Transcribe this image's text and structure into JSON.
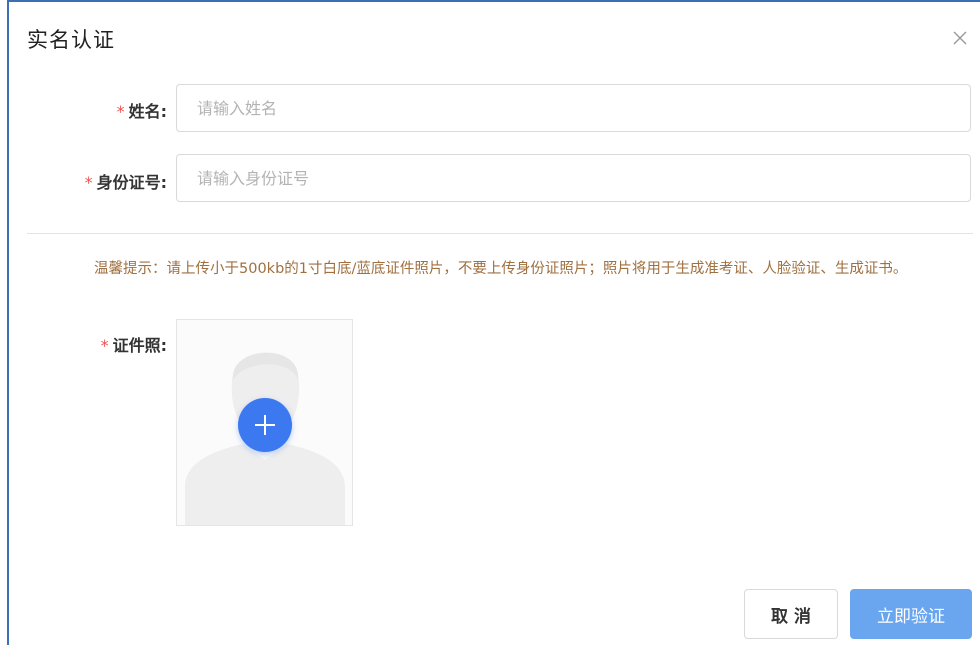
{
  "dialog": {
    "title": "实名认证",
    "close_icon": "close-icon"
  },
  "form": {
    "required_mark": "*",
    "name": {
      "label": "姓名:",
      "placeholder": "请输入姓名",
      "value": ""
    },
    "id_number": {
      "label": "身份证号:",
      "placeholder": "请输入身份证号",
      "value": ""
    },
    "hint": "温馨提示：请上传小于500kb的1寸白底/蓝底证件照片，不要上传身份证照片；照片将用于生成准考证、人脸验证、生成证书。",
    "photo": {
      "label": "证件照:",
      "upload_icon": "plus-icon",
      "placeholder_icon": "avatar-silhouette-icon"
    }
  },
  "footer": {
    "cancel_label": "取消",
    "submit_label": "立即验证"
  },
  "colors": {
    "accent": "#3c78f0",
    "submit_button": "#6aa6f0",
    "required": "#f05050",
    "hint_text": "#a07040",
    "dialog_border": "#3d6fb5"
  }
}
